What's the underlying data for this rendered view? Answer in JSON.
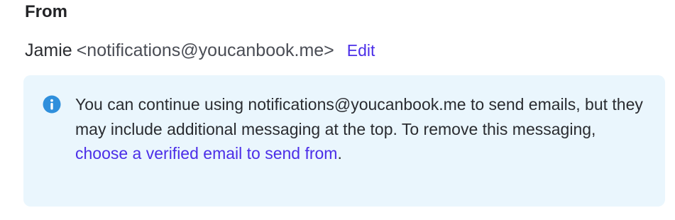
{
  "section": {
    "heading": "From"
  },
  "sender": {
    "name": "Jamie",
    "email": "<notifications@youcanbook.me>",
    "edit_label": "Edit"
  },
  "notice": {
    "icon": "info-icon",
    "text_before": "You can continue using notifications@youcanbook.me to send emails, but they may include additional messaging at the top. To remove this messaging, ",
    "link_text": "choose a verified email to send from",
    "text_after": ".",
    "background_color": "#eaf6fd",
    "link_color": "#4b2ee8",
    "icon_color": "#2f8fdc"
  }
}
